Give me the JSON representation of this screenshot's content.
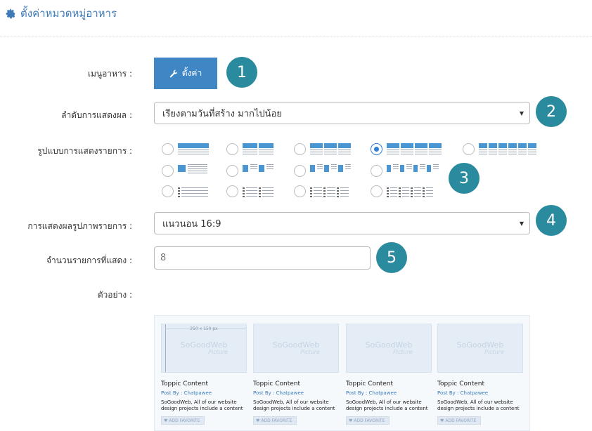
{
  "header": {
    "title": "ตั้งค่าหมวดหมู่อาหาร",
    "icon": "gear-icon",
    "color": "#3d7ab8"
  },
  "form": {
    "menu": {
      "label": "เมนูอาหาร :",
      "button_label": "ตั้งค่า",
      "button_icon": "wrench-icon"
    },
    "sort": {
      "label": "ลำดับการแสดงผล :",
      "value": "เรียงตามวันที่สร้าง มากไปน้อย"
    },
    "layout": {
      "label": "รูปแบบการแสดงรายการ :",
      "selected": "grid-4"
    },
    "image_ratio": {
      "label": "การแสดงผลรูปภาพรายการ :",
      "value": "แนวนอน 16:9"
    },
    "count": {
      "label": "จำนวนรายการที่แสดง :",
      "value": "8"
    },
    "preview_label": "ตัวอย่าง :"
  },
  "badges": [
    "1",
    "2",
    "3",
    "4",
    "5"
  ],
  "preview": {
    "dimension_text": "250 x 150 px",
    "watermark": "SoGoodWeb",
    "watermark_sub": "Picture",
    "cards": [
      {
        "title": "Toppic Content",
        "by": "Post By : Chatpawee",
        "desc": "SoGoodWeb, All of our website design projects include a content manag system to easily update your",
        "fav": "ADD FAVORITE"
      },
      {
        "title": "Toppic Content",
        "by": "Post By : Chatpawee",
        "desc": "SoGoodWeb, All of our website design projects include a content manag system to easily update your",
        "fav": "ADD FAVORITE"
      },
      {
        "title": "Toppic Content",
        "by": "Post By : Chatpawee",
        "desc": "SoGoodWeb, All of our website design projects include a content manag system to easily update your",
        "fav": "ADD FAVORITE"
      },
      {
        "title": "Toppic Content",
        "by": "Post By : Chatpawee",
        "desc": "SoGoodWeb, All of our website design projects include a content manag system to easily update your",
        "fav": "ADD FAVORITE"
      }
    ]
  },
  "colors": {
    "primary": "#3f86c5",
    "badge": "#2a8a9e",
    "icon_blue": "#4a96d3"
  }
}
